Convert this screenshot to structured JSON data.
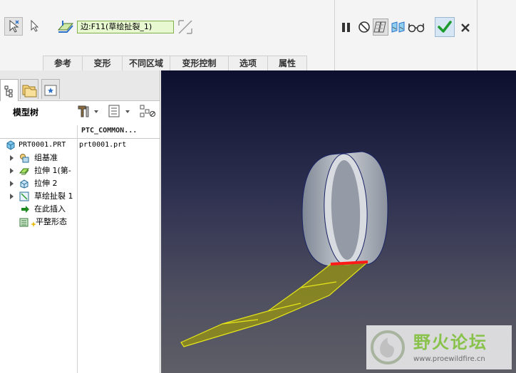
{
  "dashboard": {
    "edge_reference": "边:F11(草绘扯裂_1)",
    "tabs": [
      "参考",
      "变形",
      "不同区域",
      "变形控制",
      "选项",
      "属性"
    ]
  },
  "model_tree": {
    "title": "模型树",
    "column_header": "PTC_COMMON...",
    "items": [
      {
        "label": "PRT0001.PRT",
        "value": "prt0001.prt"
      },
      {
        "label": "组基准"
      },
      {
        "label": "拉伸 1(第-"
      },
      {
        "label": "拉伸 2"
      },
      {
        "label": "草绘扯裂 1"
      },
      {
        "label": "在此插入"
      },
      {
        "label": "平整形态"
      }
    ]
  },
  "watermark": {
    "title": "野火论坛",
    "url": "www.proewildfire.cn"
  }
}
